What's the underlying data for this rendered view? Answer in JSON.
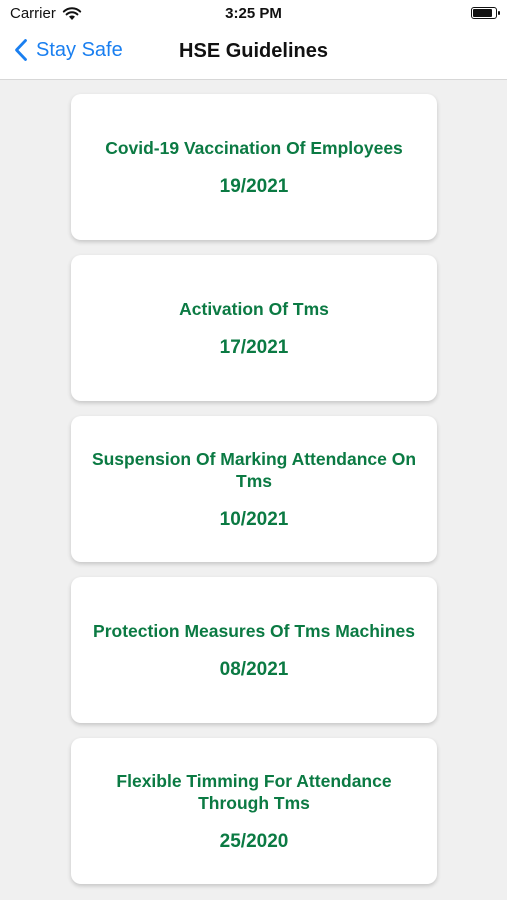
{
  "status_bar": {
    "carrier": "Carrier",
    "time": "3:25 PM",
    "icons": [
      "wifi-icon",
      "battery-icon"
    ]
  },
  "nav": {
    "back_label": "Stay Safe",
    "title": "HSE Guidelines",
    "back_icon": "chevron-left-icon"
  },
  "colors": {
    "accent": "#1a7ff0",
    "card_text": "#0b7a43",
    "background": "#f0f0f0"
  },
  "guidelines": [
    {
      "title": "Covid-19 Vaccination Of Employees",
      "number": "19/2021"
    },
    {
      "title": "Activation Of Tms",
      "number": "17/2021"
    },
    {
      "title": "Suspension Of Marking Attendance On Tms",
      "number": "10/2021"
    },
    {
      "title": "Protection Measures Of Tms Machines",
      "number": "08/2021"
    },
    {
      "title": "Flexible Timming For Attendance Through Tms",
      "number": "25/2020"
    }
  ]
}
